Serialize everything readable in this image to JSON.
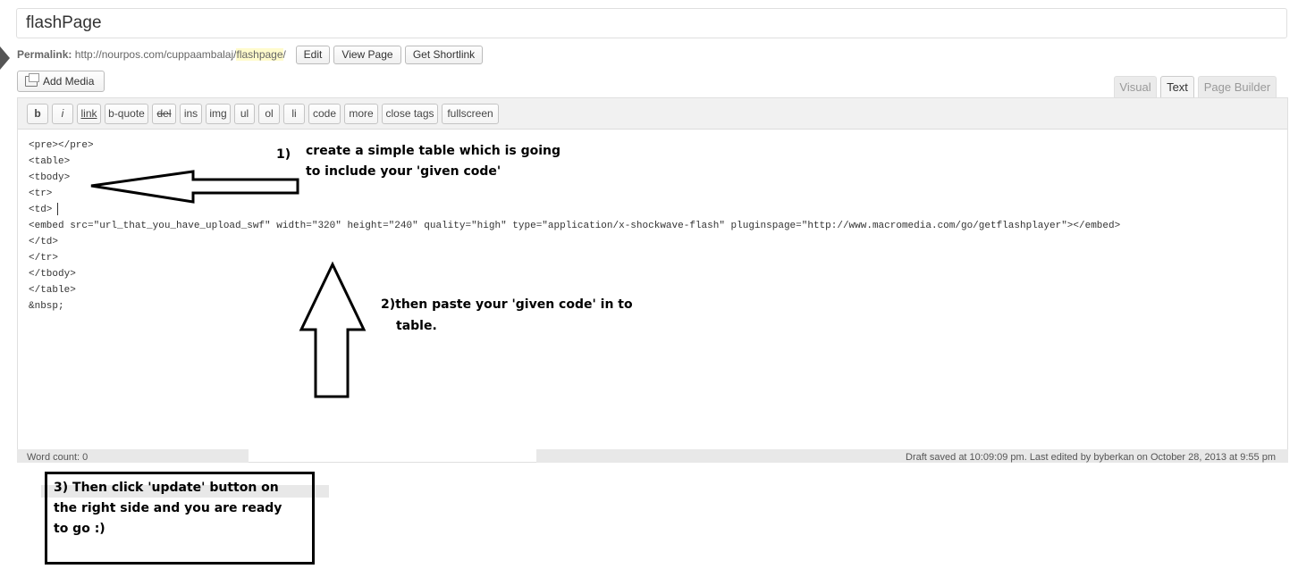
{
  "title": {
    "value": "flashPage"
  },
  "permalink": {
    "label": "Permalink:",
    "url_prefix": "http://nourpos.com/cuppaambalaj/",
    "slug": "flashpage",
    "url_suffix": "/",
    "buttons": [
      "Edit",
      "View Page",
      "Get Shortlink"
    ]
  },
  "add_media": {
    "label": "Add Media",
    "icon": "media-icon"
  },
  "tabs": [
    "Visual",
    "Text",
    "Page Builder"
  ],
  "active_tab": "Text",
  "quicktags": [
    "b",
    "i",
    "link",
    "b-quote",
    "del",
    "ins",
    "img",
    "ul",
    "ol",
    "li",
    "code",
    "more",
    "close tags",
    "fullscreen"
  ],
  "code_lines": [
    "<pre></pre>",
    "<table>",
    "<tbody>",
    "<tr>",
    "<td>",
    "<embed src=\"url_that_you_have_upload_swf\" width=\"320\" height=\"240\" quality=\"high\" type=\"application/x-shockwave-flash\" pluginspage=\"http://www.macromedia.com/go/getflashplayer\"></embed>",
    "</td>",
    "</tr>",
    "</tbody>",
    "</table>",
    "&nbsp;"
  ],
  "status": {
    "word_count": "Word count: 0",
    "draft": "Draft saved at 10:09:09 pm. Last edited by byberkan on October 28, 2013 at 9:55 pm"
  },
  "annotations": {
    "step1_num": "1)",
    "step1_line1": "create a simple table which is going",
    "step1_line2": "to include your 'given code'",
    "step2_line1": "2)then paste your 'given code' in to",
    "step2_line2": "table.",
    "step3_line1": "3) Then click 'update' button on",
    "step3_line2": "the right side and you are ready",
    "step3_line3": "to go :)"
  }
}
